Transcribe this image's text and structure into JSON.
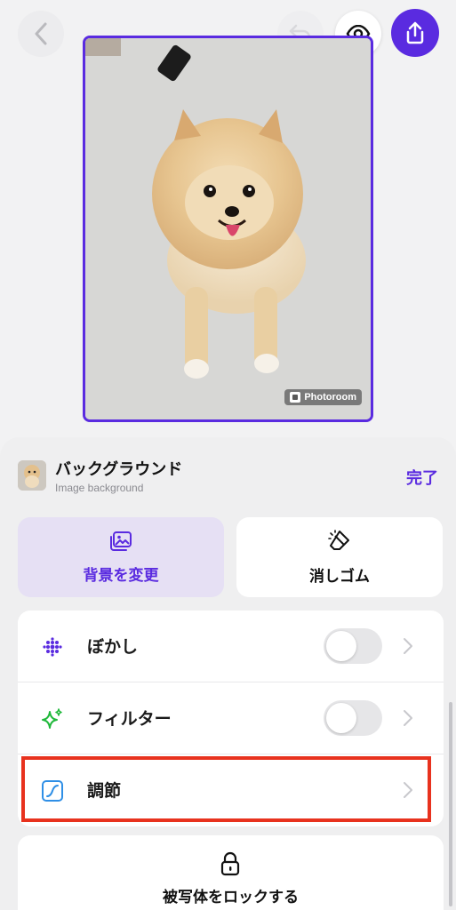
{
  "header": {
    "back_icon": "chevron-left-icon",
    "undo_icon": "undo-icon",
    "preview_icon": "eye-icon",
    "share_icon": "share-icon"
  },
  "canvas": {
    "watermark": "Photoroom"
  },
  "sheet": {
    "title": "バックグラウンド",
    "subtitle": "Image background",
    "done_label": "完了",
    "tools": [
      {
        "label": "背景を変更",
        "icon": "image-icon",
        "selected": true
      },
      {
        "label": "消しゴム",
        "icon": "eraser-icon",
        "selected": false
      }
    ],
    "rows": [
      {
        "label": "ぼかし",
        "icon": "blur-dots-icon",
        "toggle": false
      },
      {
        "label": "フィルター",
        "icon": "sparkle-icon",
        "toggle": false
      },
      {
        "label": "調節",
        "icon": "curve-adjust-icon"
      }
    ],
    "lock": {
      "label": "被写体をロックする",
      "icon": "lock-icon"
    }
  },
  "colors": {
    "accent": "#5a2be0",
    "highlight": "#e8321e",
    "selected_bg": "#e6e0f4",
    "filter_icon": "#1fb83a",
    "adjust_icon": "#2f8fe6"
  }
}
